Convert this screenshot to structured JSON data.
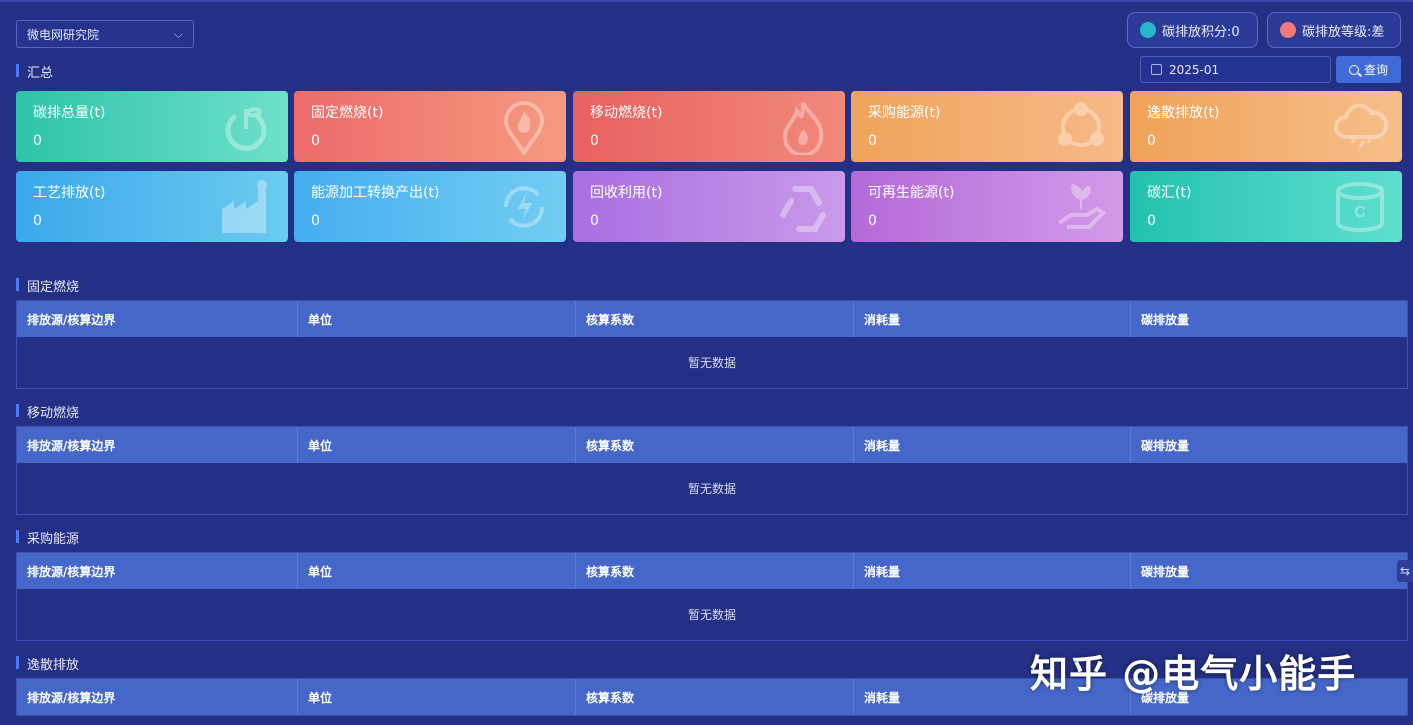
{
  "org_select": {
    "value": "微电网研究院"
  },
  "score_pill": {
    "label": "碳排放积分:0",
    "icon": "leaf-coin-icon"
  },
  "level_pill": {
    "label": "碳排放等级:差",
    "icon": "medal-icon"
  },
  "summary": {
    "title": "汇总"
  },
  "date_filter": {
    "value": "2025-01"
  },
  "query_button": {
    "label": "查询"
  },
  "cards": [
    {
      "title": "碳排总量(t)",
      "value": "0",
      "icon": "power-leaf-icon",
      "color": "#2ec4a8"
    },
    {
      "title": "固定燃烧(t)",
      "value": "0",
      "icon": "flame-pin-icon",
      "color": "#ec6b6b"
    },
    {
      "title": "移动燃烧(t)",
      "value": "0",
      "icon": "fire-icon",
      "color": "#e86161"
    },
    {
      "title": "采购能源(t)",
      "value": "0",
      "icon": "network-icon",
      "color": "#f0a45a"
    },
    {
      "title": "逸散排放(t)",
      "value": "0",
      "icon": "cloud-icon",
      "color": "#f0a258"
    },
    {
      "title": "工艺排放(t)",
      "value": "0",
      "icon": "factory-icon",
      "color": "#3aa8ea"
    },
    {
      "title": "能源加工转换产出(t)",
      "value": "0",
      "icon": "energy-cycle-icon",
      "color": "#44aef0"
    },
    {
      "title": "回收利用(t)",
      "value": "0",
      "icon": "recycle-icon",
      "color": "#a96ee0"
    },
    {
      "title": "可再生能源(t)",
      "value": "0",
      "icon": "plant-hand-icon",
      "color": "#b26ad9"
    },
    {
      "title": "碳汇(t)",
      "value": "0",
      "icon": "carbon-stack-icon",
      "color": "#23c2ae"
    }
  ],
  "columns": [
    "排放源/核算边界",
    "单位",
    "核算系数",
    "消耗量",
    "碳排放量"
  ],
  "empty_text": "暂无数据",
  "sections": [
    {
      "title": "固定燃烧"
    },
    {
      "title": "移动燃烧"
    },
    {
      "title": "采购能源"
    },
    {
      "title": "逸散排放"
    }
  ],
  "side_handle": {
    "glyph": "⇆"
  },
  "watermark": {
    "text": "知乎 @电气小能手"
  }
}
